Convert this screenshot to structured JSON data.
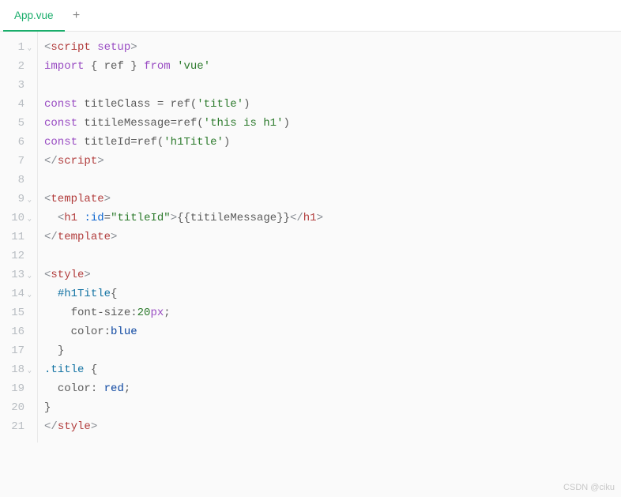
{
  "tab": {
    "name": "App.vue",
    "add_icon": "+"
  },
  "watermark": "CSDN @ciku",
  "gutter": [
    {
      "n": "1",
      "fold": true
    },
    {
      "n": "2",
      "fold": false
    },
    {
      "n": "3",
      "fold": false
    },
    {
      "n": "4",
      "fold": false
    },
    {
      "n": "5",
      "fold": false
    },
    {
      "n": "6",
      "fold": false
    },
    {
      "n": "7",
      "fold": false
    },
    {
      "n": "8",
      "fold": false
    },
    {
      "n": "9",
      "fold": true
    },
    {
      "n": "10",
      "fold": true
    },
    {
      "n": "11",
      "fold": false
    },
    {
      "n": "12",
      "fold": false
    },
    {
      "n": "13",
      "fold": true
    },
    {
      "n": "14",
      "fold": true
    },
    {
      "n": "15",
      "fold": false
    },
    {
      "n": "16",
      "fold": false
    },
    {
      "n": "17",
      "fold": false
    },
    {
      "n": "18",
      "fold": true
    },
    {
      "n": "19",
      "fold": false
    },
    {
      "n": "20",
      "fold": false
    },
    {
      "n": "21",
      "fold": false
    }
  ],
  "code": [
    [
      [
        "brkt",
        "<"
      ],
      [
        "tag",
        "script"
      ],
      [
        "",
        ""
      ],
      [
        "attr-purple",
        " setup"
      ],
      [
        "brkt",
        ">"
      ]
    ],
    [
      [
        "kw",
        "import"
      ],
      [
        "",
        " "
      ],
      [
        "pn",
        "{ "
      ],
      [
        "id",
        "ref"
      ],
      [
        "pn",
        " }"
      ],
      [
        "",
        " "
      ],
      [
        "kw",
        "from"
      ],
      [
        "",
        " "
      ],
      [
        "str",
        "'vue'"
      ]
    ],
    [],
    [
      [
        "kw",
        "const"
      ],
      [
        "",
        " "
      ],
      [
        "id",
        "titleClass"
      ],
      [
        "",
        " "
      ],
      [
        "pn",
        "="
      ],
      [
        "",
        " "
      ],
      [
        "id",
        "ref"
      ],
      [
        "pn",
        "("
      ],
      [
        "str",
        "'title'"
      ],
      [
        "pn",
        ")"
      ]
    ],
    [
      [
        "kw",
        "const"
      ],
      [
        "",
        " "
      ],
      [
        "id",
        "titileMessage"
      ],
      [
        "pn",
        "="
      ],
      [
        "id",
        "ref"
      ],
      [
        "pn",
        "("
      ],
      [
        "str",
        "'this is h1'"
      ],
      [
        "pn",
        ")"
      ]
    ],
    [
      [
        "kw",
        "const"
      ],
      [
        "",
        " "
      ],
      [
        "id",
        "titleId"
      ],
      [
        "pn",
        "="
      ],
      [
        "id",
        "ref"
      ],
      [
        "pn",
        "("
      ],
      [
        "str",
        "'h1Title'"
      ],
      [
        "pn",
        ")"
      ]
    ],
    [
      [
        "brkt",
        "</"
      ],
      [
        "tag",
        "script"
      ],
      [
        "brkt",
        ">"
      ]
    ],
    [],
    [
      [
        "brkt",
        "<"
      ],
      [
        "tag",
        "template"
      ],
      [
        "brkt",
        ">"
      ]
    ],
    [
      [
        "",
        "  "
      ],
      [
        "brkt",
        "<"
      ],
      [
        "tag",
        "h1"
      ],
      [
        "",
        " "
      ],
      [
        "attr-blue",
        ":id"
      ],
      [
        "pn",
        "="
      ],
      [
        "str",
        "\"titleId\""
      ],
      [
        "brkt",
        ">"
      ],
      [
        "mustache",
        "{{"
      ],
      [
        "id",
        "titileMessage"
      ],
      [
        "mustache",
        "}}"
      ],
      [
        "brkt",
        "</"
      ],
      [
        "tag",
        "h1"
      ],
      [
        "brkt",
        ">"
      ]
    ],
    [
      [
        "brkt",
        "</"
      ],
      [
        "tag",
        "template"
      ],
      [
        "brkt",
        ">"
      ]
    ],
    [],
    [
      [
        "brkt",
        "<"
      ],
      [
        "tag",
        "style"
      ],
      [
        "brkt",
        ">"
      ]
    ],
    [
      [
        "",
        "  "
      ],
      [
        "css-sel",
        "#h1Title"
      ],
      [
        "pn",
        "{"
      ]
    ],
    [
      [
        "",
        "    "
      ],
      [
        "css-prop",
        "font-size"
      ],
      [
        "pn",
        ":"
      ],
      [
        "css-val-num",
        "20"
      ],
      [
        "css-unit",
        "px"
      ],
      [
        "pn",
        ";"
      ]
    ],
    [
      [
        "",
        "    "
      ],
      [
        "css-prop",
        "color"
      ],
      [
        "pn",
        ":"
      ],
      [
        "css-val-kw",
        "blue"
      ]
    ],
    [
      [
        "",
        "  "
      ],
      [
        "pn",
        "}"
      ]
    ],
    [
      [
        "css-sel",
        ".title"
      ],
      [
        "",
        " "
      ],
      [
        "pn",
        "{"
      ]
    ],
    [
      [
        "",
        "  "
      ],
      [
        "css-prop",
        "color"
      ],
      [
        "pn",
        ": "
      ],
      [
        "css-val-kw",
        "red"
      ],
      [
        "pn",
        ";"
      ]
    ],
    [
      [
        "pn",
        "}"
      ]
    ],
    [
      [
        "brkt",
        "</"
      ],
      [
        "tag",
        "style"
      ],
      [
        "brkt",
        ">"
      ]
    ]
  ]
}
